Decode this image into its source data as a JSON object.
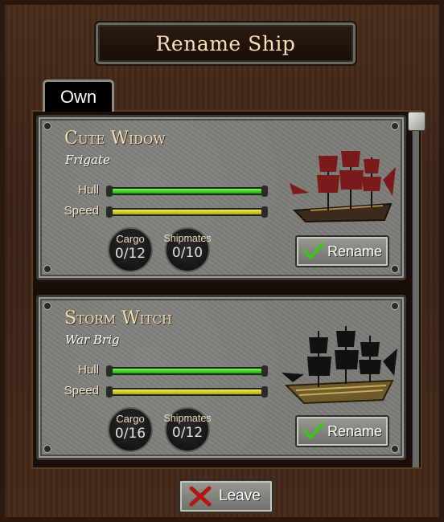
{
  "window": {
    "title": "Rename Ship"
  },
  "tabs": [
    {
      "label": "Own",
      "active": true
    }
  ],
  "stat_labels": {
    "hull": "Hull",
    "speed": "Speed",
    "cargo": "Cargo",
    "shipmates": "Shipmates"
  },
  "ships": [
    {
      "name": "Cute Widow",
      "type": "Frigate",
      "hull_fraction": 1.0,
      "speed_fraction": 1.0,
      "cargo": "0/12",
      "shipmates": "0/10",
      "sail_color": "#7a1a1a",
      "rename_label": "Rename"
    },
    {
      "name": "Storm Witch",
      "type": "War Brig",
      "hull_fraction": 1.0,
      "speed_fraction": 1.0,
      "cargo": "0/16",
      "shipmates": "0/12",
      "sail_color": "#111111",
      "rename_label": "Rename"
    }
  ],
  "footer": {
    "leave_label": "Leave"
  },
  "colors": {
    "hull_bar": "#2fd61e",
    "speed_bar": "#d2d22a",
    "title_text": "#f3e2b8"
  }
}
